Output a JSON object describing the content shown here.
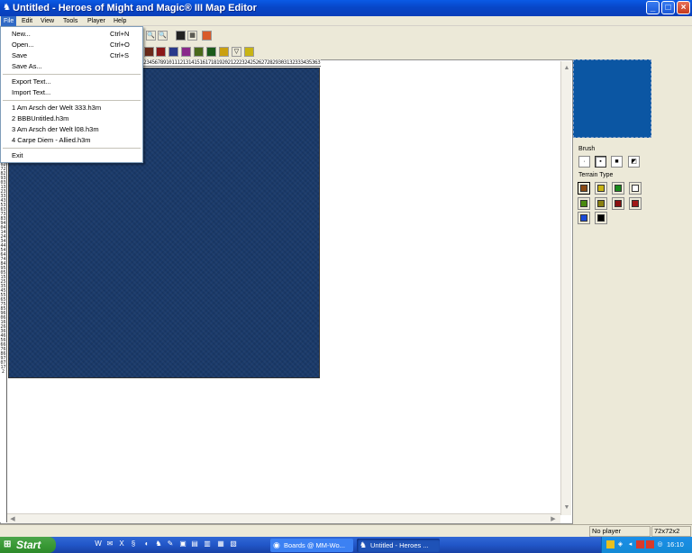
{
  "window": {
    "title": "Untitled - Heroes of Might and Magic® III Map Editor",
    "controls": {
      "minimize": "_",
      "maximize": "□",
      "close": "×"
    }
  },
  "menubar": [
    "File",
    "Edit",
    "View",
    "Tools",
    "Player",
    "Help"
  ],
  "file_menu": {
    "items": [
      {
        "label": "New...",
        "shortcut": "Ctrl+N"
      },
      {
        "label": "Open...",
        "shortcut": "Ctrl+O"
      },
      {
        "label": "Save",
        "shortcut": "Ctrl+S"
      },
      {
        "label": "Save As...",
        "shortcut": ""
      }
    ],
    "export": [
      "Export Text...",
      "Import Text..."
    ],
    "recent": [
      "1 Am Arsch der Welt 333.h3m",
      "2 BBBUntitled.h3m",
      "3 Am Arsch der Welt l08.h3m",
      "4 Carpe Diem - Allied.h3m"
    ],
    "exit": "Exit"
  },
  "ruler": {
    "top": "1234567891011121314151617181920212223242526272829303132333435363738394041424344454647484950515253545556575859606162636465666768697071",
    "left": "123456789101112131415161718192021222324252627282930313233343536373839404142434445464748495051525354555657585960616263646566676869707172"
  },
  "panel": {
    "brush_label": "Brush",
    "terrain_label": "Terrain Type",
    "brushes": [
      "·",
      "▪",
      "■",
      "◩"
    ],
    "terrain_colors": [
      "#8a4a12",
      "#c8b414",
      "#1a8a1a",
      "#ffffff",
      "#4a8a10",
      "#8a8010",
      "#8a1010",
      "#a01818",
      "#1a4ad8",
      "#000000"
    ]
  },
  "status": {
    "player": "No player",
    "size": "72x72x2"
  },
  "taskbar": {
    "start": "Start",
    "tasks": [
      "Boards @ MM-Wo...",
      "Untitled - Heroes ..."
    ],
    "clock": "16:10"
  },
  "colors": {
    "water": "#1a3a6a",
    "minimap": "#0b56a3",
    "accent": "#316ac5"
  }
}
